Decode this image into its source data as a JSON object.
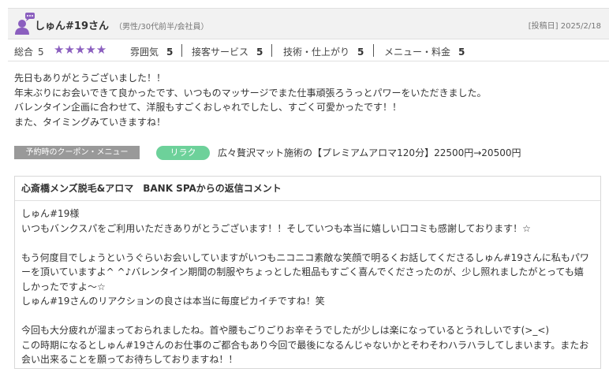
{
  "header": {
    "username": "しゅん#19さん",
    "userinfo": "（男性/30代前半/会社員）",
    "postdate": "[投稿日] 2025/2/18"
  },
  "ratings": {
    "overall_label": "総合",
    "overall_value": "5",
    "stars": "★★★★★",
    "star_count": 5,
    "items": [
      {
        "label": "雰囲気",
        "value": "5"
      },
      {
        "label": "接客サービス",
        "value": "5"
      },
      {
        "label": "技術・仕上がり",
        "value": "5"
      },
      {
        "label": "メニュー・料金",
        "value": "5"
      }
    ]
  },
  "comment": {
    "lines": [
      "先日もありがとうございました！！",
      "年末ぶりにお会いできて良かったです、いつものマッサージでまた仕事頑張ろうっとパワーをいただきました。",
      "バレンタイン企画に合わせて、洋服もすごくおしゃれでしたし、すごく可愛かったです！！",
      "また、タイミングみていきますね！"
    ]
  },
  "coupon": {
    "label": "予約時のクーポン・メニュー",
    "tag": "リラク",
    "text": "広々贅沢マット施術の【プレミアムアロマ120分】22500円→20500円"
  },
  "reply": {
    "title": "心斎橋メンズ脱毛&アロマ　BANK SPAからの返信コメント",
    "lines": [
      "しゅん#19様",
      "いつもバンクスパをご利用いただきありがとうございます！！そしていつも本当に嬉しい口コミも感謝しております！☆",
      "",
      "もう何度目でしょうというぐらいお会いしていますがいつもニコニコ素敵な笑顔で明るくお話してくださるしゅん#19さんに私もパワ",
      "ーを頂いていますよ^ ^♪バレンタイン期間の制服やちょっとした粗品もすごく喜んでくださったのが、少し照れましたがとっても嬉",
      "しかったですよ〜☆",
      "しゅん#19さんのリアクションの良さは本当に毎度ピカイチですね！笑",
      "",
      "今回も大分疲れが溜まっておられましたね。首や腰もごりごりお辛そうでしたが少しは楽になっているとうれしいです(>_<)",
      "この時期になるとしゅん#19さんのお仕事のご都合もあり今回で最後になるんじゃないかとそわそわハラハラしてしまいます。またお",
      "会い出来ることを願ってお待ちしておりますね！！"
    ]
  },
  "colors": {
    "star": "#8b5fbf",
    "avatar": "#8b5fbf",
    "tag": "#6dd19a",
    "coupon_label_bg": "#999999"
  }
}
